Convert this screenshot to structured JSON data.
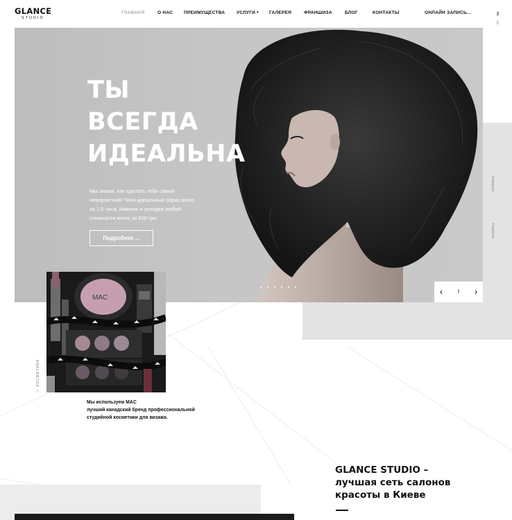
{
  "logo": {
    "main": "GLANCE",
    "sub": "STUDIO"
  },
  "nav": {
    "items": [
      {
        "label": "ГЛАВНАЯ",
        "active": true
      },
      {
        "label": "О НАС"
      },
      {
        "label": "ПРЕИМУЩЕСТВА"
      },
      {
        "label": "УСЛУГИ",
        "dropdown": true
      },
      {
        "label": "ГАЛЕРЕЯ"
      },
      {
        "label": "ФРАНШИЗА"
      },
      {
        "label": "БЛОГ"
      },
      {
        "label": "КОНТАКТЫ"
      }
    ],
    "cta": "ОНЛАЙН ЗАПИСЬ...",
    "caret": "▾"
  },
  "lang": [
    "ru",
    "ukr"
  ],
  "hero": {
    "title_lines": [
      "ТЫ",
      "ВСЕГДА",
      "ИДЕАЛЬНА"
    ],
    "text": "Мы знаем, как сделать тебя самой невероятной! Твой идеальный образ всего за 1,5 часа. Макияж и укладка любой сложности всего за 600 грн.",
    "button": "Подробнее ..."
  },
  "slider": {
    "prev": "‹",
    "counter": "I",
    "next": "›"
  },
  "social": [
    "Instagram",
    "Facebook"
  ],
  "cosmetics": {
    "label": "— КОСМЕТИКА",
    "brand_text": "MAC",
    "lines": [
      "Мы используем MAC",
      "лучший канадский бренд профессиональной",
      "студийной косметики для визажа."
    ]
  },
  "studio": {
    "lines": [
      "GLANCE STUDIO –",
      "лучшая сеть салонов",
      "красоты в Киеве"
    ]
  },
  "colors": {
    "accent": "#111111",
    "hero_bg": "#c4c4c4",
    "panel_grey": "#e3e3e3"
  }
}
